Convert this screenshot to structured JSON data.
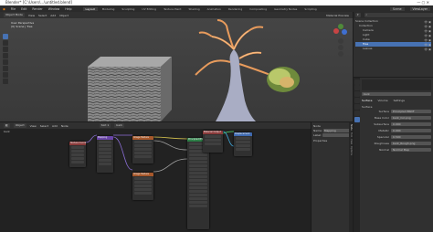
{
  "app": {
    "window_title": "Blender* [C:\\Users\\...\\untitled.blend]",
    "menu": [
      "File",
      "Edit",
      "Render",
      "Window",
      "Help"
    ],
    "workspaces": [
      "Layout",
      "Modeling",
      "Sculpting",
      "UV Editing",
      "Texture Paint",
      "Shading",
      "Animation",
      "Rendering",
      "Compositing",
      "Geometry Nodes",
      "Scripting"
    ],
    "active_workspace": "Layout",
    "scene": "Scene",
    "view_layer": "ViewLayer"
  },
  "viewport": {
    "mode": "Object Mode",
    "menus": [
      "View",
      "Select",
      "Add",
      "Object"
    ],
    "overlay_line1": "User Perspective",
    "overlay_line2": "(0) Scene | Tree",
    "shading": "Material Preview"
  },
  "node_editor": {
    "mode": "Object",
    "menus": [
      "View",
      "Select",
      "Add",
      "Node"
    ],
    "slot": "Slot 1",
    "material": "bark",
    "breadcrumb": "bark"
  },
  "outliner": {
    "title": "Scene Collection",
    "items": [
      "Collection",
      "Camera",
      "Light",
      "Cube",
      "Tree",
      "Leaves"
    ],
    "selected": "Tree"
  },
  "properties": {
    "tabs": [
      "Surface",
      "Volume",
      "Settings"
    ],
    "material_name": "bark",
    "surface_label": "Surface",
    "shader": "Principled BSDF",
    "fields": [
      {
        "label": "Base Color",
        "value": "bark_Col.png"
      },
      {
        "label": "Subsurface",
        "value": "0.000"
      },
      {
        "label": "Metallic",
        "value": "0.000"
      },
      {
        "label": "Specular",
        "value": "0.500"
      },
      {
        "label": "Roughness",
        "value": "bark_Rough.png"
      },
      {
        "label": "Normal",
        "value": "Normal Map"
      }
    ]
  },
  "node_sidebar": {
    "tabs": [
      "Node",
      "Tool",
      "View",
      "Options"
    ],
    "section": "Node",
    "name_label": "Name:",
    "name_value": "Mapping",
    "label_label": "Label:",
    "properties_label": "Properties"
  },
  "nodes": [
    {
      "title": "Texture Coordinate",
      "header_color": "#8a3b3b"
    },
    {
      "title": "Mapping",
      "header_color": "#6a45a8"
    },
    {
      "title": "Image Texture",
      "header_color": "#a7582b"
    },
    {
      "title": "Image Texture",
      "header_color": "#a7582b"
    },
    {
      "title": "Principled BSDF",
      "header_color": "#2e8048"
    },
    {
      "title": "Material Output",
      "header_color": "#8a3b3b"
    },
    {
      "title": "Displacement",
      "header_color": "#3f6ab0"
    }
  ],
  "colors": {
    "accent": "#4772b3",
    "selected_object": "#e89b5c"
  }
}
